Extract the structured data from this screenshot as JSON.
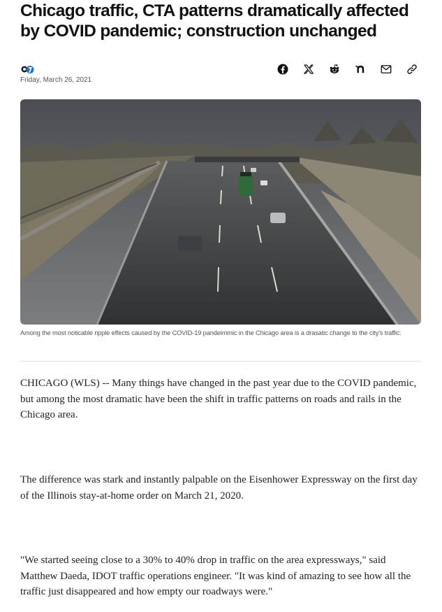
{
  "article": {
    "headline": "Chicago traffic, CTA patterns dramatically affected by COVID pandemic; construction unchanged",
    "date": "Friday, March 26, 2021",
    "image_caption": "Among the most noticable ripple effects caused by the COVID-19 pandeimmic in the Chicago area is a drasatic change to the city's traffic.",
    "paragraphs": [
      "CHICAGO (WLS) -- Many things have changed in the past year due to the COVID pandemic, but among the most dramatic have been the shift in traffic patterns on roads and rails in the Chicago area.",
      "The difference was stark and instantly palpable on the Eisenhower Expressway on the first day of the Illinois stay-at-home order on March 21, 2020.",
      "\"We started seeing close to a 30% to 40% drop in traffic on the area expressways,\" said Matthew Daeda, IDOT traffic operations engineer. \"It was kind of amazing to see how all the traffic just disappeared and how empty our roadways were.\""
    ]
  },
  "share_icons": [
    "facebook-icon",
    "x-icon",
    "reddit-icon",
    "nextdoor-icon",
    "email-icon",
    "link-icon"
  ],
  "colors": {
    "text": "#111111",
    "caption": "#555555",
    "divider": "#e1e1e1"
  }
}
